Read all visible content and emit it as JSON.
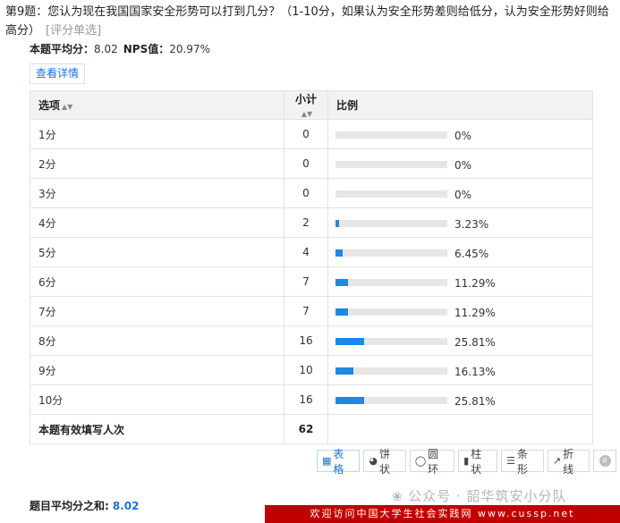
{
  "question": {
    "title": "第9题：您认为现在我国国家安全形势可以打到几分？（1-10分，如果认为安全形势差则给低分，认为安全形势好则给高分）",
    "type_tag": "[评分单选]"
  },
  "stats": {
    "avg_label": "本题平均分：",
    "avg_value": "8.02",
    "nps_label": "NPS值：",
    "nps_value": "20.97%"
  },
  "detail_button": "查看详情",
  "table": {
    "headers": {
      "option": "选项",
      "count": "小计",
      "ratio": "比例"
    },
    "rows": [
      {
        "option": "1分",
        "count": "0",
        "pct": "0%",
        "fraction": 0
      },
      {
        "option": "2分",
        "count": "0",
        "pct": "0%",
        "fraction": 0
      },
      {
        "option": "3分",
        "count": "0",
        "pct": "0%",
        "fraction": 0
      },
      {
        "option": "4分",
        "count": "2",
        "pct": "3.23%",
        "fraction": 0.0323
      },
      {
        "option": "5分",
        "count": "4",
        "pct": "6.45%",
        "fraction": 0.0645
      },
      {
        "option": "6分",
        "count": "7",
        "pct": "11.29%",
        "fraction": 0.1129
      },
      {
        "option": "7分",
        "count": "7",
        "pct": "11.29%",
        "fraction": 0.1129
      },
      {
        "option": "8分",
        "count": "16",
        "pct": "25.81%",
        "fraction": 0.2581
      },
      {
        "option": "9分",
        "count": "10",
        "pct": "16.13%",
        "fraction": 0.1613
      },
      {
        "option": "10分",
        "count": "16",
        "pct": "25.81%",
        "fraction": 0.2581
      }
    ],
    "total_label": "本题有效填写人次",
    "total_value": "62"
  },
  "toolbar": {
    "table": "表格",
    "pie": "饼状",
    "ring": "圆环",
    "column": "柱状",
    "bar": "条形",
    "line": "折线"
  },
  "summary": {
    "label": "题目平均分之和:",
    "value": "8.02"
  },
  "watermark": "公众号 · 韶华筑安小分队",
  "banner": "欢迎访问中国大学生社会实践网  www.cussp.net",
  "colors": {
    "accent": "#1a73d8",
    "bar": "#1e88e5",
    "banner": "#c00000"
  }
}
